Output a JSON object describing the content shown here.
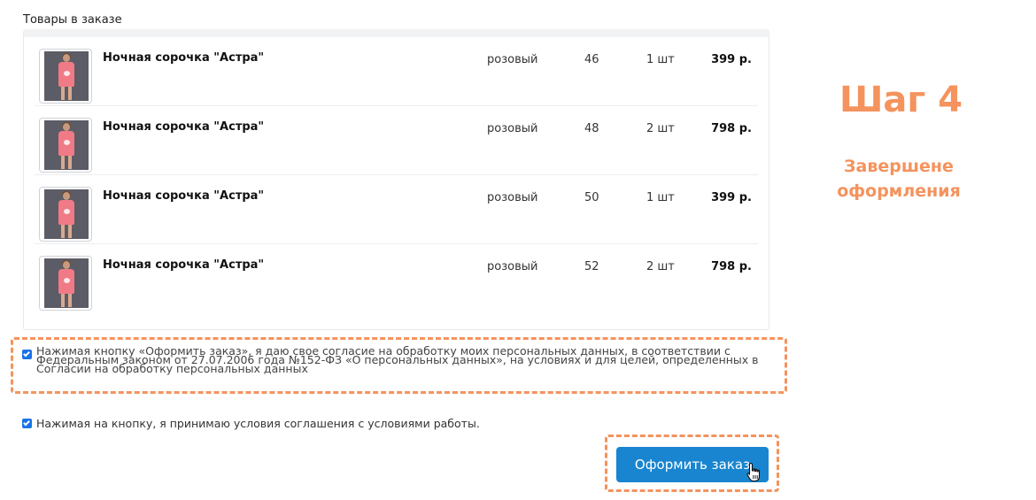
{
  "section_title": "Товары в заказе",
  "order_items": [
    {
      "name": "Ночная сорочка \"Астра\"",
      "color": "розовый",
      "size": "46",
      "quantity": "1 шт",
      "price": "399 р."
    },
    {
      "name": "Ночная сорочка \"Астра\"",
      "color": "розовый",
      "size": "48",
      "quantity": "2 шт",
      "price": "798 р."
    },
    {
      "name": "Ночная сорочка \"Астра\"",
      "color": "розовый",
      "size": "50",
      "quantity": "1 шт",
      "price": "399 р."
    },
    {
      "name": "Ночная сорочка \"Астра\"",
      "color": "розовый",
      "size": "52",
      "quantity": "2 шт",
      "price": "798 р."
    }
  ],
  "consent": {
    "checked": true,
    "text": "Нажимая кнопку «Оформить заказ», я даю свое согласие на обработку моих персональных данных, в соответствии с Федеральным законом от 27.07.2006 года №152-ФЗ «О персональных данных», на условиях и для целей, определенных в Согласии на обработку персональных данных"
  },
  "agreement": {
    "checked": true,
    "text": "Нажимая на кнопку, я принимаю условия соглашения с условиями работы."
  },
  "submit_label": "Оформить заказ",
  "step": {
    "title": "Шаг 4",
    "subtitle_line1": "Завершене",
    "subtitle_line2": "оформления"
  },
  "colors": {
    "accent": "#f4935d",
    "button": "#1985d0",
    "checkbox": "#1a73e8"
  },
  "icons": {
    "cursor": "hand-pointer-icon",
    "checkbox": "checkbox-checked-icon"
  }
}
